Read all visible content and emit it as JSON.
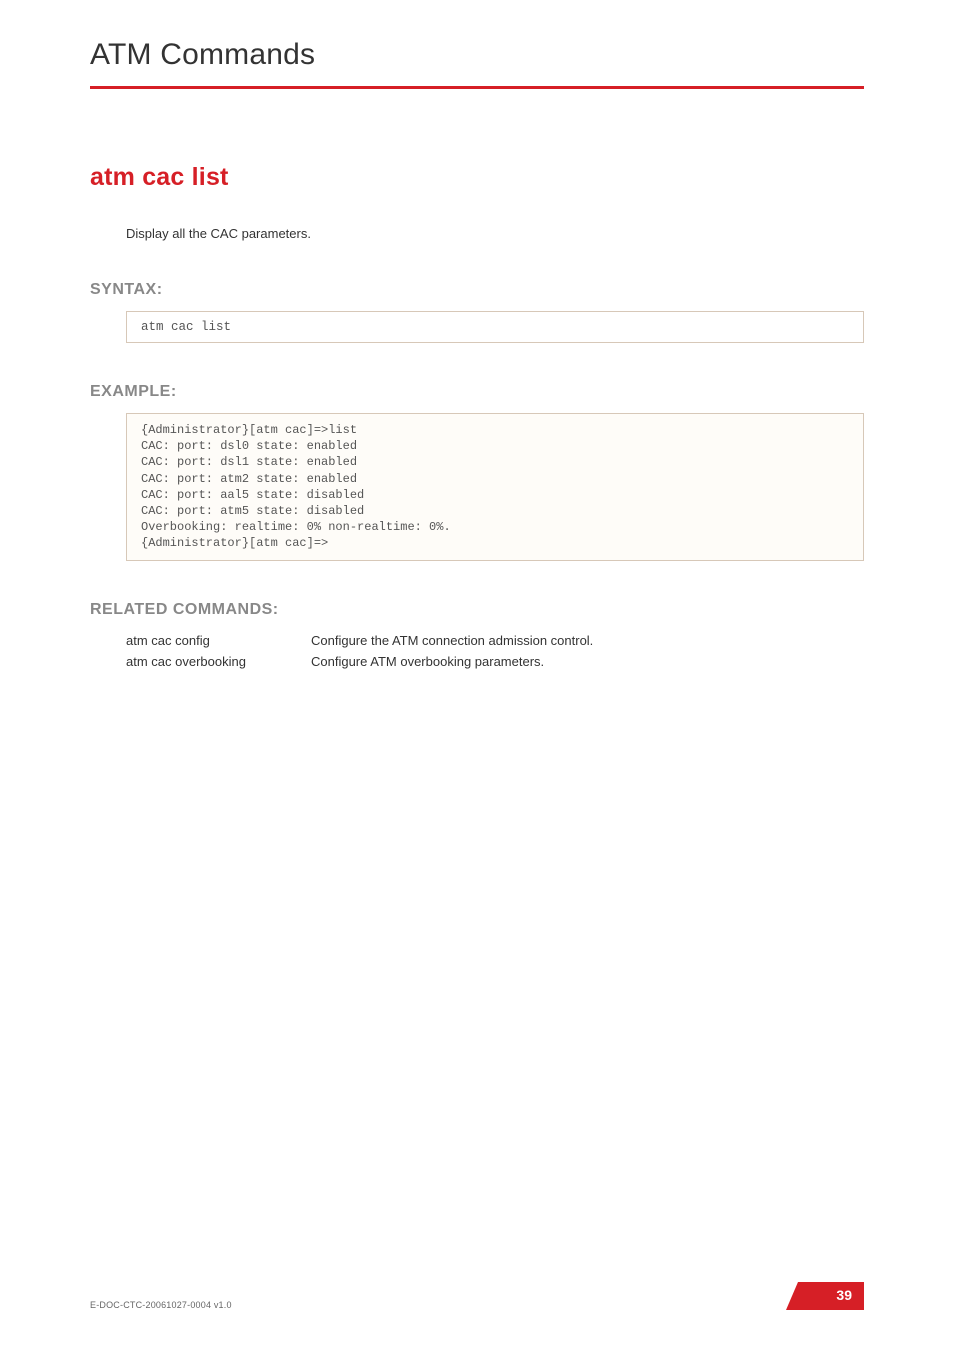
{
  "header": {
    "section_title": "ATM Commands"
  },
  "command": {
    "title": "atm cac list",
    "description": "Display all the CAC parameters."
  },
  "syntax": {
    "heading": "SYNTAX:",
    "code": "atm cac list"
  },
  "example": {
    "heading": "EXAMPLE:",
    "code": "{Administrator}[atm cac]=>list\nCAC: port: dsl0 state: enabled\nCAC: port: dsl1 state: enabled\nCAC: port: atm2 state: enabled\nCAC: port: aal5 state: disabled\nCAC: port: atm5 state: disabled\nOverbooking: realtime: 0% non-realtime: 0%.\n{Administrator}[atm cac]=>"
  },
  "related": {
    "heading": "RELATED COMMANDS:",
    "rows": [
      {
        "cmd": "atm cac config",
        "desc": "Configure the ATM connection admission control."
      },
      {
        "cmd": "atm cac overbooking",
        "desc": "Configure ATM overbooking parameters."
      }
    ]
  },
  "footer": {
    "doc_id": "E-DOC-CTC-20061027-0004 v1.0",
    "page_number": "39"
  }
}
